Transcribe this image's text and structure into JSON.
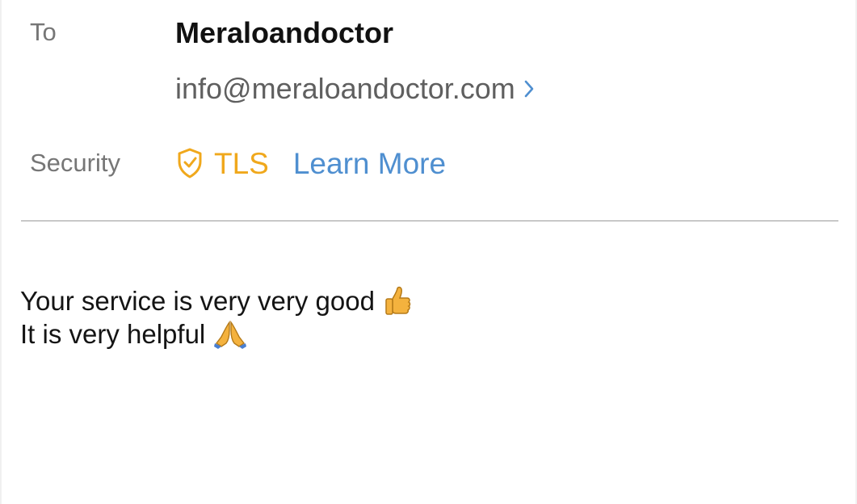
{
  "header": {
    "to_label": "To",
    "sender_name": "Meraloandoctor",
    "sender_email": "info@meraloandoctor.com",
    "security_label": "Security",
    "security_protocol": "TLS",
    "learn_more_label": "Learn More"
  },
  "message": {
    "lines": [
      {
        "text": "Your service is very very good",
        "emoji": "thumbs-up-icon"
      },
      {
        "text": "It is very helpful",
        "emoji": "folded-hands-icon"
      }
    ]
  },
  "colors": {
    "tls": "#f0a81c",
    "link": "#4f8fd0",
    "label": "#767676"
  }
}
